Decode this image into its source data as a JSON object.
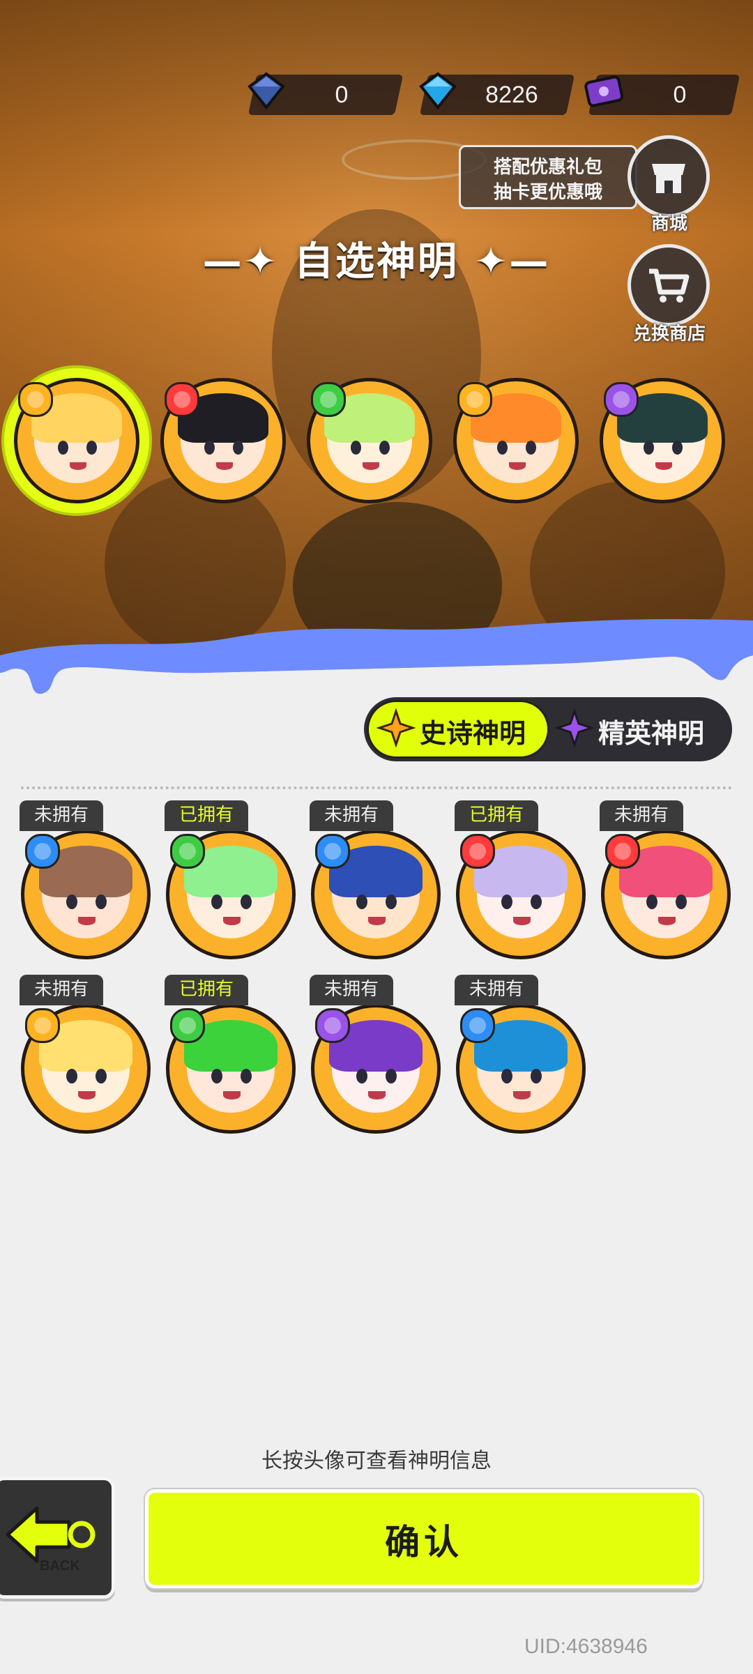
{
  "currencies": [
    {
      "icon": "dark-gem-icon",
      "value": "0"
    },
    {
      "icon": "blue-gem-icon",
      "value": "8226"
    },
    {
      "icon": "purple-ticket-icon",
      "value": "0"
    }
  ],
  "promo": {
    "line1": "搭配优惠礼包",
    "line2": "抽卡更优惠哦"
  },
  "buttons": {
    "shop": "商城",
    "exchange": "兑换商店"
  },
  "title": "自选神明",
  "featured": [
    {
      "element": "#ffb321",
      "hair": "#ffd460",
      "skin": "#ffe8d2",
      "selected": true
    },
    {
      "element": "#ff3b3b",
      "hair": "#1e1e24",
      "skin": "#ffe7d6",
      "selected": false
    },
    {
      "element": "#3fcc45",
      "hair": "#bff07a",
      "skin": "#fff0dc",
      "selected": false
    },
    {
      "element": "#ffb321",
      "hair": "#ff8a2a",
      "skin": "#ffe6d0",
      "selected": false
    },
    {
      "element": "#9a52e8",
      "hair": "#23403f",
      "skin": "#fff0e2",
      "selected": false
    }
  ],
  "tabs": {
    "epic": "史诗神明",
    "elite": "精英神明"
  },
  "gods": [
    {
      "status": "未拥有",
      "owned": false,
      "element": "#2d8df5",
      "hair": "#9a6a52",
      "skin": "#ffe4d4"
    },
    {
      "status": "已拥有",
      "owned": true,
      "element": "#3fcc45",
      "hair": "#8ef08e",
      "skin": "#ffeedd"
    },
    {
      "status": "未拥有",
      "owned": false,
      "element": "#2d8df5",
      "hair": "#2e4fb5",
      "skin": "#ffe5cc"
    },
    {
      "status": "已拥有",
      "owned": true,
      "element": "#ff3b3b",
      "hair": "#c8b8f0",
      "skin": "#fff0ee"
    },
    {
      "status": "未拥有",
      "owned": false,
      "element": "#ff3b3b",
      "hair": "#f0507a",
      "skin": "#ffe8de"
    },
    {
      "status": "未拥有",
      "owned": false,
      "element": "#ffb321",
      "hair": "#ffe070",
      "skin": "#fff0dc"
    },
    {
      "status": "已拥有",
      "owned": true,
      "element": "#3fcc45",
      "hair": "#3bd23b",
      "skin": "#ffe8da"
    },
    {
      "status": "未拥有",
      "owned": false,
      "element": "#9a52e8",
      "hair": "#7a3bc8",
      "skin": "#fff0f0"
    },
    {
      "status": "未拥有",
      "owned": false,
      "element": "#2d8df5",
      "hair": "#1e90d8",
      "skin": "#ffe7d4"
    }
  ],
  "hint": "长按头像可查看神明信息",
  "back_label": "BACK",
  "confirm": "确认",
  "uid": "UID:4638946"
}
